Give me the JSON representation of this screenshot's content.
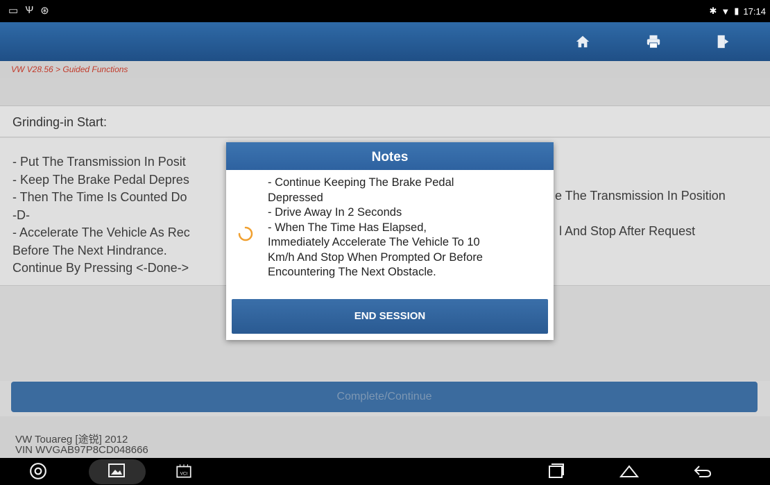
{
  "status_bar": {
    "time": "17:14",
    "left_icons": [
      "sim-icon",
      "usb-icon",
      "android-debug-icon"
    ],
    "right_icons": [
      "bluetooth-icon",
      "wifi-icon",
      "battery-icon"
    ]
  },
  "toolbar": {
    "icons": [
      "home-icon",
      "print-icon",
      "exit-icon"
    ]
  },
  "breadcrumb": "VW V28.56 > Guided Functions",
  "section_title": "Grinding-in Start:",
  "instructions": {
    "lines": [
      "- Put The Transmission In Posit",
      "- Keep The Brake Pedal Depres",
      "- Then The Time Is Counted Do",
      "-D-",
      "- Accelerate The Vehicle As Rec",
      "Before The Next Hindrance.",
      "Continue By Pressing <-Done->"
    ],
    "right_fragments": [
      "e The Transmission In Position",
      "l And Stop After Request"
    ]
  },
  "continue_button": "Complete/Continue",
  "footer": {
    "vehicle": "VW Touareg [途锐] 2012",
    "vin": "VIN WVGAB97P8CD048666"
  },
  "dialog": {
    "title": "Notes",
    "body_lines": [
      "- Continue Keeping The Brake Pedal",
      "Depressed",
      "- Drive Away In 2 Seconds",
      "- When The Time Has Elapsed,",
      "Immediately Accelerate The Vehicle To 10",
      "Km/h And Stop When Prompted Or Before",
      "Encountering The Next Obstacle."
    ],
    "button": "END SESSION"
  },
  "colors": {
    "toolbar": "#2a5d97",
    "breadcrumb_text": "#c23a2a",
    "dialog_header": "#3468a5",
    "spinner": "#f0a030"
  }
}
